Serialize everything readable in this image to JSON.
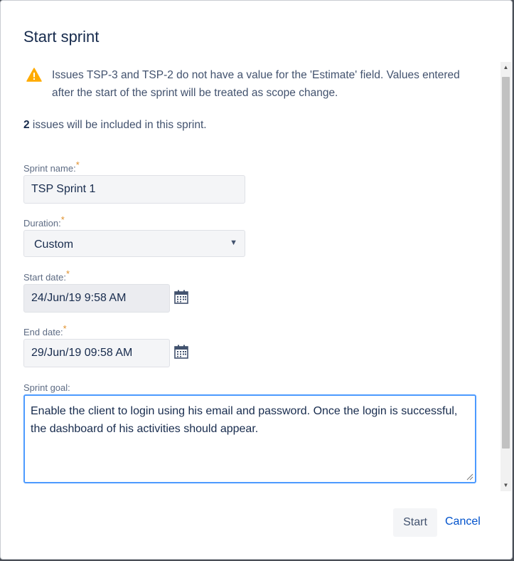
{
  "dialog": {
    "title": "Start sprint",
    "warning_text": "Issues TSP-3 and TSP-2 do not have a value for the 'Estimate' field. Values entered after the start of the sprint will be treated as scope change.",
    "issues_count": "2",
    "issues_text": " issues will be included in this sprint."
  },
  "form": {
    "sprint_name_label": "Sprint name:",
    "sprint_name_value": "TSP Sprint 1",
    "duration_label": "Duration:",
    "duration_value": "Custom",
    "start_date_label": "Start date:",
    "start_date_value": "24/Jun/19 9:58 AM",
    "end_date_label": "End date:",
    "end_date_value": "29/Jun/19 09:58 AM",
    "sprint_goal_label": "Sprint goal:",
    "sprint_goal_value": "Enable the client to login using his email and password. Once the login is successful, the dashboard of his activities should appear.",
    "required_marker": "*"
  },
  "actions": {
    "start_label": "Start",
    "cancel_label": "Cancel"
  },
  "icons": {
    "warning": "warning-icon",
    "calendar": "calendar-icon",
    "dropdown": "chevron-down-icon"
  },
  "colors": {
    "warning": "#ffab00",
    "link": "#0052cc",
    "focus_border": "#4c9aff",
    "required": "#e0902b"
  }
}
